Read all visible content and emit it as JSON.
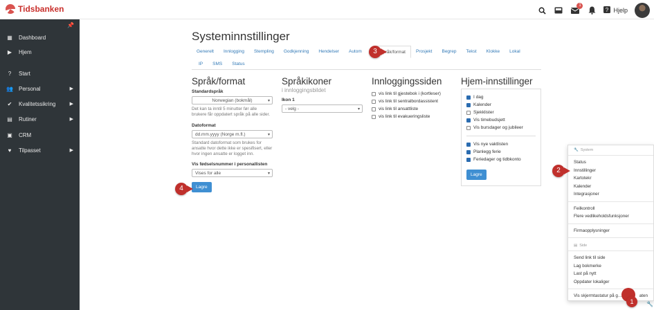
{
  "app": {
    "name": "Tidsbanken"
  },
  "topbar": {
    "help_label": "Hjelp",
    "mail_count": "1",
    "icons": [
      "search-icon",
      "inbox-icon",
      "mail-icon",
      "bell-icon",
      "help-icon"
    ]
  },
  "sidebar": {
    "items": [
      {
        "label": "Dashboard",
        "icon": "dashboard-icon"
      },
      {
        "label": "Hjem",
        "icon": "play-icon"
      },
      {
        "label": "Start",
        "icon": "question-icon"
      },
      {
        "label": "Personal",
        "icon": "users-icon"
      },
      {
        "label": "Kvalitetssikring",
        "icon": "check-icon"
      },
      {
        "label": "Rutiner",
        "icon": "list-icon"
      },
      {
        "label": "CRM",
        "icon": "crm-icon"
      },
      {
        "label": "Tilpasset",
        "icon": "heart-icon"
      }
    ]
  },
  "page": {
    "title": "Systeminnstillinger",
    "tabs_row1": [
      "Generelt",
      "Innlogging",
      "Stempling",
      "Godkjenning",
      "Hendelser",
      "Autom",
      "Språk/format",
      "Prosjekt",
      "Begrep",
      "Tekst",
      "Klokke",
      "Lokal"
    ],
    "tabs_row2": [
      "IP",
      "SMS",
      "Status"
    ],
    "active_tab": "Språk/format"
  },
  "sprak": {
    "title": "Språk/format",
    "std_label": "Standardspråk",
    "std_value": "Norwegian (bokmål)",
    "std_help": "Det kan ta inntil 5 minutter før alle brukere får oppdatert språk på alle sider.",
    "date_label": "Datoformat",
    "date_value": "dd.mm.yyyy (Norge m.fl.)",
    "date_help": "Standard datoformat som brukes for ansatte hvor dette ikke er spesifisert, eller hvor ingen ansatte er logget inn.",
    "birth_label": "Vis fødselsnummer i personallisten",
    "birth_value": "Vises for alle",
    "save": "Lagre"
  },
  "ikoner": {
    "title": "Språkikoner",
    "subtitle": "i innloggingsbildet",
    "icon_label": "Ikon 1",
    "icon_value": "- velg -"
  },
  "innlogging": {
    "title": "Innloggingssiden",
    "options": [
      "vis link til gjestebok i (kortleser)",
      "vis link til sentralbordassistent",
      "vis link til ansattliste",
      "vis link til evakueringsliste"
    ]
  },
  "hjem": {
    "title": "Hjem-innstillinger",
    "group1": [
      {
        "label": "I dag",
        "checked": true
      },
      {
        "label": "Kalender",
        "checked": true
      },
      {
        "label": "Sjekklister",
        "checked": false
      },
      {
        "label": "Vis timebudsjett",
        "checked": true
      },
      {
        "label": "Vis bursdager og jubileer",
        "checked": false
      }
    ],
    "group2": [
      {
        "label": "Vis nye vaktlisten",
        "checked": true
      },
      {
        "label": "Planlegg ferie",
        "checked": true
      },
      {
        "label": "Feriedager og tidbkonto",
        "checked": true
      }
    ],
    "save": "Lagre"
  },
  "dropdown": {
    "system_header": "System",
    "system_items": [
      "Status",
      "Innstillinger",
      "Kartotekr",
      "Kalender",
      "Integrasjoner"
    ],
    "maint_items": [
      "Feilkontroll",
      "Flere vedlikeholdsfunksjoner"
    ],
    "firm_items": [
      "Firmaopplysninger"
    ],
    "side_header": "Side",
    "side_items": [
      "Send link til side",
      "Lag bokmerke",
      "Last på nytt",
      "Oppdater lokaliger"
    ],
    "bottom_item": "Vis skjermtastatur på g…",
    "bottom_suffix": "aten"
  },
  "callouts": [
    "1",
    "2",
    "3",
    "4"
  ],
  "colors": {
    "sidebar": "#2f3539",
    "accent": "#3f8fd2",
    "callout": "#c0302c",
    "brand": "#c9302c"
  }
}
